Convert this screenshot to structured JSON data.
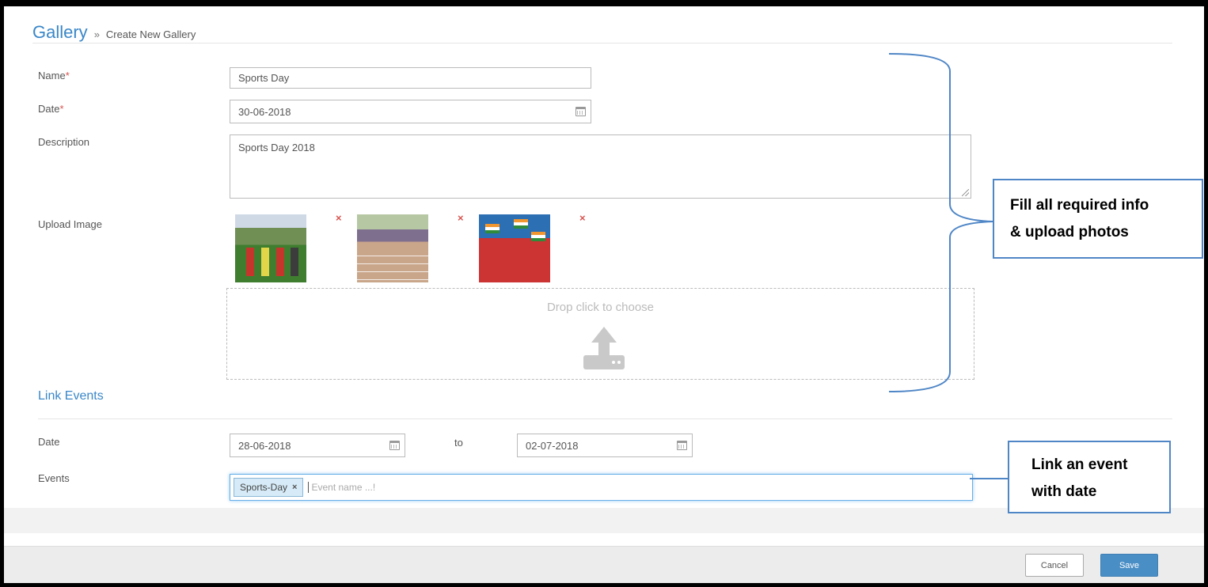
{
  "breadcrumb": {
    "title": "Gallery",
    "separator": "»",
    "current": "Create New Gallery"
  },
  "form": {
    "name": {
      "label": "Name",
      "required_mark": "*",
      "value": "Sports Day"
    },
    "date": {
      "label": "Date",
      "required_mark": "*",
      "value": "30-06-2018",
      "icon": "calendar-icon"
    },
    "description": {
      "label": "Description",
      "value": "Sports Day 2018"
    },
    "upload": {
      "label": "Upload Image",
      "remove_symbol": "×",
      "dropzone_text": "Drop click to choose",
      "dropzone_icon": "upload-icon"
    }
  },
  "link_events": {
    "title": "Link Events",
    "date_label": "Date",
    "date_from": "28-06-2018",
    "to_label": "to",
    "date_to": "02-07-2018",
    "events_label": "Events",
    "tags": [
      "Sports-Day"
    ],
    "tag_remove": "×",
    "events_placeholder": "Event name ...!"
  },
  "footer": {
    "cancel_label": "Cancel",
    "save_label": "Save"
  },
  "annotations": {
    "callout1_line1": "Fill all required info",
    "callout1_line2": "& upload photos",
    "callout2_line1": "Link an event",
    "callout2_line2": "with date"
  },
  "colors": {
    "accent": "#3a87c8",
    "required": "#d9534f",
    "save_button": "#4a8ec6",
    "callout_border": "#4f86c6"
  }
}
